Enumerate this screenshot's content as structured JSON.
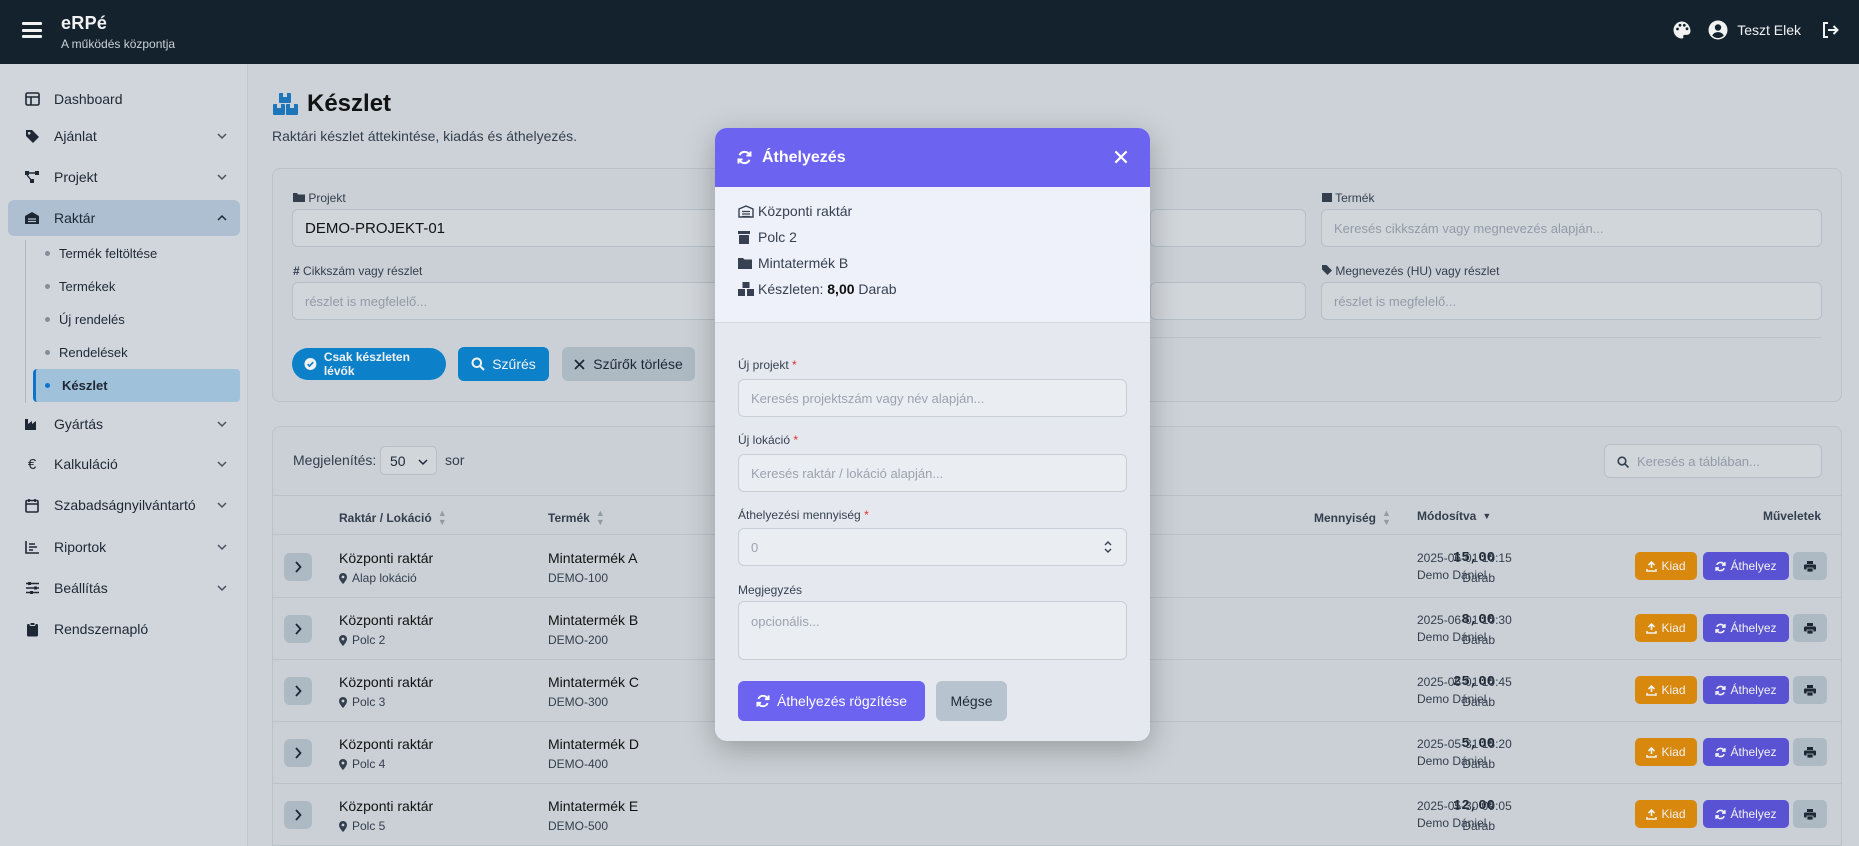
{
  "app": {
    "name": "eRPé",
    "tagline": "A működés központja",
    "user": "Teszt Elek"
  },
  "sidebar": {
    "items": [
      {
        "label": "Dashboard"
      },
      {
        "label": "Ajánlat"
      },
      {
        "label": "Projekt"
      },
      {
        "label": "Raktár"
      },
      {
        "label": "Gyártás"
      },
      {
        "label": "Kalkuláció"
      },
      {
        "label": "Szabadságnyilvántartó"
      },
      {
        "label": "Riportok"
      },
      {
        "label": "Beállítás"
      },
      {
        "label": "Rendszernapló"
      }
    ],
    "sub_items": [
      {
        "label": "Termék feltöltése"
      },
      {
        "label": "Termékek"
      },
      {
        "label": "Új rendelés"
      },
      {
        "label": "Rendelések"
      },
      {
        "label": "Készlet"
      }
    ],
    "kalk_symbol": "€"
  },
  "page": {
    "title": "Készlet",
    "subtitle": "Raktári készlet áttekintése, kiadás és áthelyezés."
  },
  "filters": {
    "projekt_label": "Projekt",
    "projekt_value": "DEMO-PROJEKT-01",
    "termek_label": "Termék",
    "termek_placeholder": "Keresés cikkszám vagy megnevezés alapján...",
    "cikkszam_label": "Cikkszám vagy részlet",
    "cikkszam_placeholder": "részlet is megfelelő...",
    "megnevezes_label": "Megnevezés (HU) vagy részlet",
    "megnevezes_placeholder": "részlet is megfelelő...",
    "stock_only": "Csak készleten lévők",
    "filter_btn": "Szűrés",
    "clear_btn": "Szűrők törlése"
  },
  "table": {
    "show_label": "Megjelenítés:",
    "page_size": "50",
    "rows_label": "sor",
    "search_placeholder": "Keresés a táblában...",
    "headers": {
      "location": "Raktár / Lokáció",
      "product": "Termék",
      "quantity": "Mennyiség",
      "modified": "Módosítva",
      "actions": "Műveletek"
    },
    "rows": [
      {
        "warehouse": "Központi raktár",
        "location": "Alap lokáció",
        "product": "Mintatermék A",
        "sku": "DEMO-100",
        "qty": "15,00",
        "unit": "Darab",
        "date": "2025-06-01 10:15",
        "by": "Demo Dániel"
      },
      {
        "warehouse": "Központi raktár",
        "location": "Polc 2",
        "product": "Mintatermék B",
        "sku": "DEMO-200",
        "qty": "8,00",
        "unit": "Darab",
        "date": "2025-06-01 10:30",
        "by": "Demo Dániel"
      },
      {
        "warehouse": "Központi raktár",
        "location": "Polc 3",
        "product": "Mintatermék C",
        "sku": "DEMO-300",
        "qty": "25,00",
        "unit": "Darab",
        "date": "2025-06-01 10:45",
        "by": "Demo Dániel"
      },
      {
        "warehouse": "Központi raktár",
        "location": "Polc 4",
        "product": "Mintatermék D",
        "sku": "DEMO-400",
        "qty": "5,00",
        "unit": "Darab",
        "date": "2025-05-31 15:20",
        "by": "Demo Dániel"
      },
      {
        "warehouse": "Központi raktár",
        "location": "Polc 5",
        "product": "Mintatermék E",
        "sku": "DEMO-500",
        "qty": "12,00",
        "unit": "Darab",
        "date": "2025-05-30 09:05",
        "by": "Demo Dániel"
      }
    ],
    "action_kiad": "Kiad",
    "action_athelyez": "Áthelyez"
  },
  "modal": {
    "title": "Áthelyezés",
    "warehouse": "Központi raktár",
    "location": "Polc 2",
    "product": "Mintatermék B",
    "stock_label": "Készleten:",
    "stock_qty": "8,00",
    "stock_unit": "Darab",
    "new_project_label": "Új projekt",
    "new_project_placeholder": "Keresés projektszám vagy név alapján...",
    "new_location_label": "Új lokáció",
    "new_location_placeholder": "Keresés raktár / lokáció alapján...",
    "qty_label": "Áthelyezési mennyiség",
    "qty_placeholder": "0",
    "note_label": "Megjegyzés",
    "note_placeholder": "opcionális...",
    "required_mark": "*",
    "submit": "Áthelyezés rögzítése",
    "cancel": "Mégse"
  },
  "colors": {
    "accent": "#6c63f0",
    "primary": "#0c86d4",
    "warning": "#e48f0c",
    "topbar": "#15222e"
  }
}
